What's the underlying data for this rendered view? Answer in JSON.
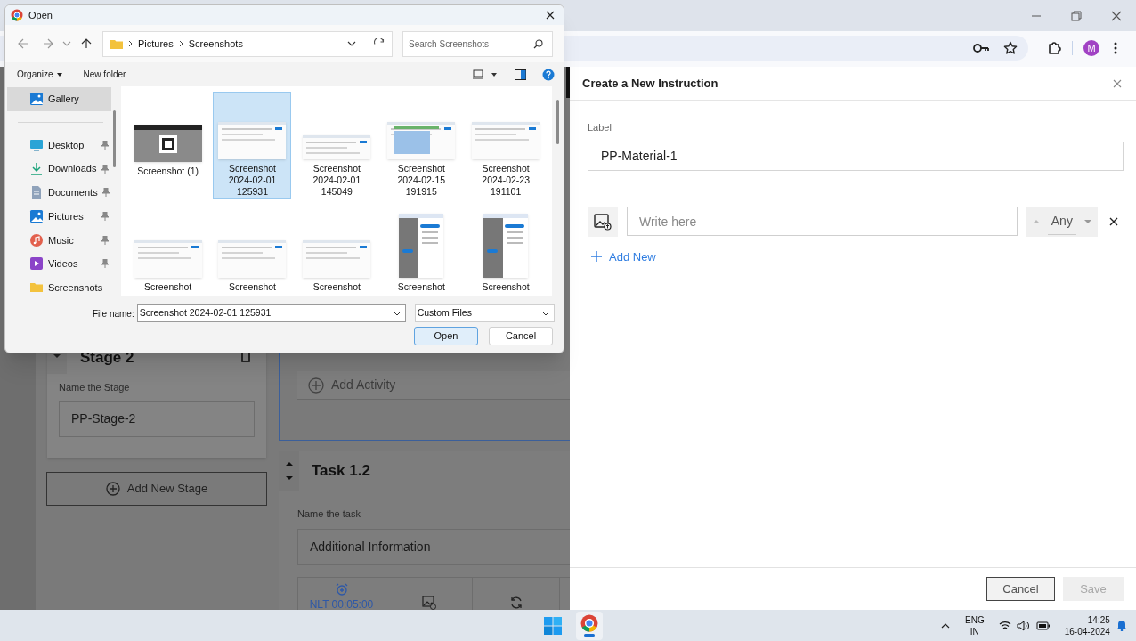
{
  "browser": {
    "profile_initial": "M"
  },
  "app_background": {
    "stage": {
      "title": "Stage 2",
      "field_label": "Name the Stage",
      "value": "PP-Stage-2"
    },
    "add_stage": "Add New Stage",
    "add_activity": "Add Activity",
    "task": {
      "title": "Task 1.2",
      "field_label": "Name the task",
      "value": "Additional Information",
      "timer": "NLT 00:05:00"
    }
  },
  "drawer": {
    "title": "Create a New Instruction",
    "label": "Label",
    "label_value": "PP-Material-1",
    "row": {
      "placeholder": "Write here",
      "select": "Any"
    },
    "add_new": "Add New",
    "buttons": [
      {
        "label": "Cancel",
        "disabled": false
      },
      {
        "label": "Save",
        "disabled": true
      }
    ]
  },
  "dialog": {
    "title": "Open",
    "breadcrumb": [
      "Pictures",
      "Screenshots"
    ],
    "search_placeholder": "Search Screenshots",
    "toolbar": [
      "Organize",
      "New folder"
    ],
    "nav": [
      {
        "label": "Gallery",
        "pinned": false,
        "selected": true
      },
      {
        "label": "Desktop",
        "pinned": true,
        "selected": false
      },
      {
        "label": "Downloads",
        "pinned": true,
        "selected": false
      },
      {
        "label": "Documents",
        "pinned": true,
        "selected": false
      },
      {
        "label": "Pictures",
        "pinned": true,
        "selected": false
      },
      {
        "label": "Music",
        "pinned": true,
        "selected": false
      },
      {
        "label": "Videos",
        "pinned": true,
        "selected": false
      },
      {
        "label": "Screenshots",
        "pinned": false,
        "selected": false
      }
    ],
    "files": [
      {
        "name": "Screenshot (1)",
        "selected": false
      },
      {
        "name": "Screenshot 2024-02-01 125931",
        "selected": true
      },
      {
        "name": "Screenshot 2024-02-01 145049",
        "selected": false
      },
      {
        "name": "Screenshot 2024-02-15 191915",
        "selected": false
      },
      {
        "name": "Screenshot 2024-02-23 191101",
        "selected": false
      },
      {
        "name": "Screenshot",
        "selected": false
      },
      {
        "name": "Screenshot",
        "selected": false
      },
      {
        "name": "Screenshot",
        "selected": false
      },
      {
        "name": "Screenshot",
        "selected": false
      },
      {
        "name": "Screenshot",
        "selected": false
      }
    ],
    "file_name_label": "File name:",
    "file_name": "Screenshot 2024-02-01 125931",
    "filter": "Custom Files",
    "buttons": [
      "Open",
      "Cancel"
    ]
  },
  "taskbar": {
    "language": "ENG",
    "region": "IN",
    "time": "14:25",
    "date": "16-04-2024"
  }
}
